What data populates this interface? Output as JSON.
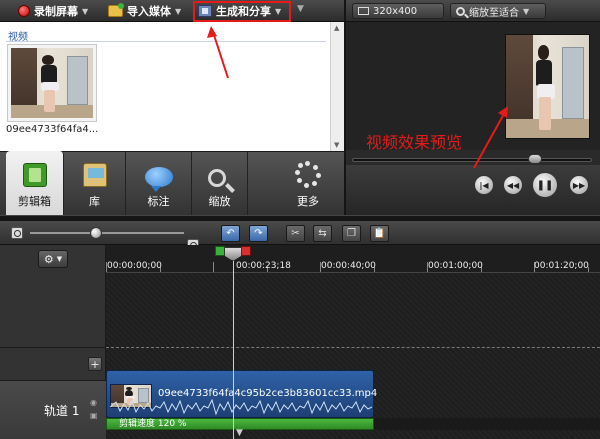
{
  "toolbar": {
    "record_label": "录制屏幕",
    "import_label": "导入媒体",
    "produce_label": "生成和分享"
  },
  "bin": {
    "section_label": "视频",
    "items": [
      {
        "name": "09ee4733f64fa4..."
      }
    ]
  },
  "tabs": [
    {
      "label": "剪辑箱",
      "icon": "clip-bin-icon",
      "active": true
    },
    {
      "label": "库",
      "icon": "library-icon",
      "active": false
    },
    {
      "label": "标注",
      "icon": "callout-icon",
      "active": false
    },
    {
      "label": "缩放",
      "icon": "zoom-icon",
      "active": false
    },
    {
      "label": "更多",
      "icon": "more-icon",
      "active": false
    }
  ],
  "preview": {
    "dimensions_label": "320x400",
    "fit_label": "缩放至适合",
    "annotation": "视频效果预览"
  },
  "timeline": {
    "ruler_labels": [
      "00:00:00;00",
      "00:00:23;18",
      "00:00:40;00",
      "00:01:00;00",
      "00:01:20;00"
    ],
    "track_name": "轨道 1",
    "clip_name": "09ee4733f64fa4c95b2ce3b83601cc33.mp4",
    "clip_speed": "剪辑速度 120 %",
    "playhead_position": "00:00:23;18"
  },
  "colors": {
    "annotation_red": "#e41b1b",
    "clip_blue": "#2f62a8",
    "speed_green": "#4cb840"
  }
}
